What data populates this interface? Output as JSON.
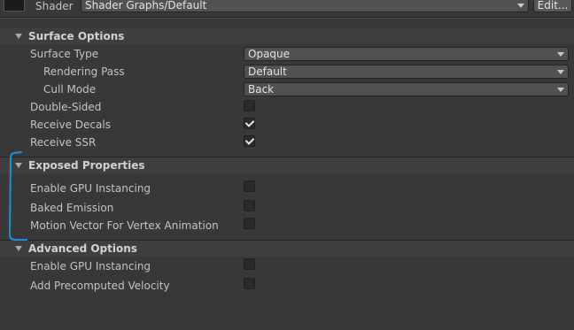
{
  "header": {
    "shader_label": "Shader",
    "shader_value": "Shader Graphs/Default",
    "edit_label": "Edit..."
  },
  "surface_options": {
    "title": "Surface Options",
    "surface_type": {
      "label": "Surface Type",
      "value": "Opaque"
    },
    "rendering_pass": {
      "label": "Rendering Pass",
      "value": "Default"
    },
    "cull_mode": {
      "label": "Cull Mode",
      "value": "Back"
    },
    "double_sided": {
      "label": "Double-Sided",
      "checked": false
    },
    "receive_decals": {
      "label": "Receive Decals",
      "checked": true
    },
    "receive_ssr": {
      "label": "Receive SSR",
      "checked": true
    }
  },
  "exposed_properties": {
    "title": "Exposed Properties",
    "items": [
      {
        "label": "Enable GPU Instancing",
        "checked": false
      },
      {
        "label": "Baked Emission",
        "checked": false
      },
      {
        "label": "Motion Vector For Vertex Animation",
        "checked": false
      }
    ]
  },
  "advanced_options": {
    "title": "Advanced Options",
    "items": [
      {
        "label": "Enable GPU Instancing",
        "checked": false
      },
      {
        "label": "Add Precomputed Velocity",
        "checked": false
      }
    ]
  },
  "annotation": {
    "color": "#1e8fd6"
  }
}
